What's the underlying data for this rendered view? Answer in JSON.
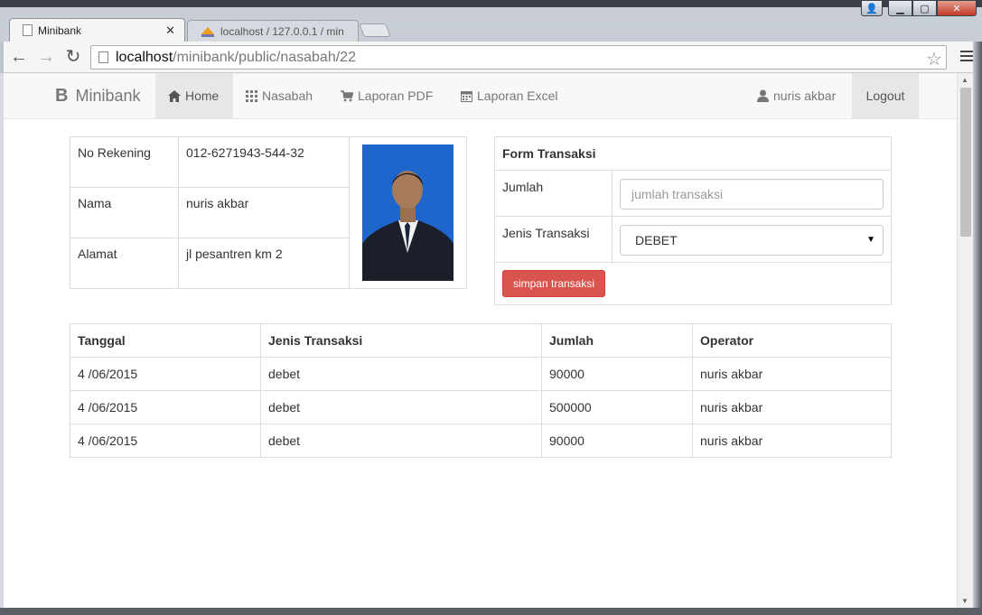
{
  "browser": {
    "tabs": [
      {
        "label": "Minibank",
        "close": "✕"
      },
      {
        "label": "localhost / 127.0.0.1 / min"
      }
    ],
    "url_host": "localhost",
    "url_path": "/minibank/public/nasabah/22"
  },
  "navbar": {
    "brand_icon": "B",
    "brand": "Minibank",
    "items": [
      {
        "label": "Home",
        "icon": "home-icon"
      },
      {
        "label": "Nasabah",
        "icon": "grid-icon"
      },
      {
        "label": "Laporan PDF",
        "icon": "cart-icon"
      },
      {
        "label": "Laporan Excel",
        "icon": "calendar-icon"
      }
    ],
    "user": "nuris akbar",
    "logout": "Logout"
  },
  "customer": {
    "rows": [
      {
        "label": "No Rekening",
        "value": "012-6271943-544-32"
      },
      {
        "label": "Nama",
        "value": "nuris akbar"
      },
      {
        "label": "Alamat",
        "value": "jl pesantren km 2"
      }
    ]
  },
  "form": {
    "title": "Form Transaksi",
    "jumlah_label": "Jumlah",
    "jumlah_placeholder": "jumlah transaksi",
    "jenis_label": "Jenis Transaksi",
    "jenis_value": "DEBET",
    "submit": "simpan transaksi"
  },
  "transactions": {
    "headers": [
      "Tanggal",
      "Jenis Transaksi",
      "Jumlah",
      "Operator"
    ],
    "rows": [
      [
        "4 /06/2015",
        "debet",
        "90000",
        "nuris akbar"
      ],
      [
        "4 /06/2015",
        "debet",
        "500000",
        "nuris akbar"
      ],
      [
        "4 /06/2015",
        "debet",
        "90000",
        "nuris akbar"
      ]
    ]
  },
  "colors": {
    "danger": "#d9534f",
    "navbar_bg": "#f8f8f8",
    "photo_bg": "#1d63c8"
  }
}
